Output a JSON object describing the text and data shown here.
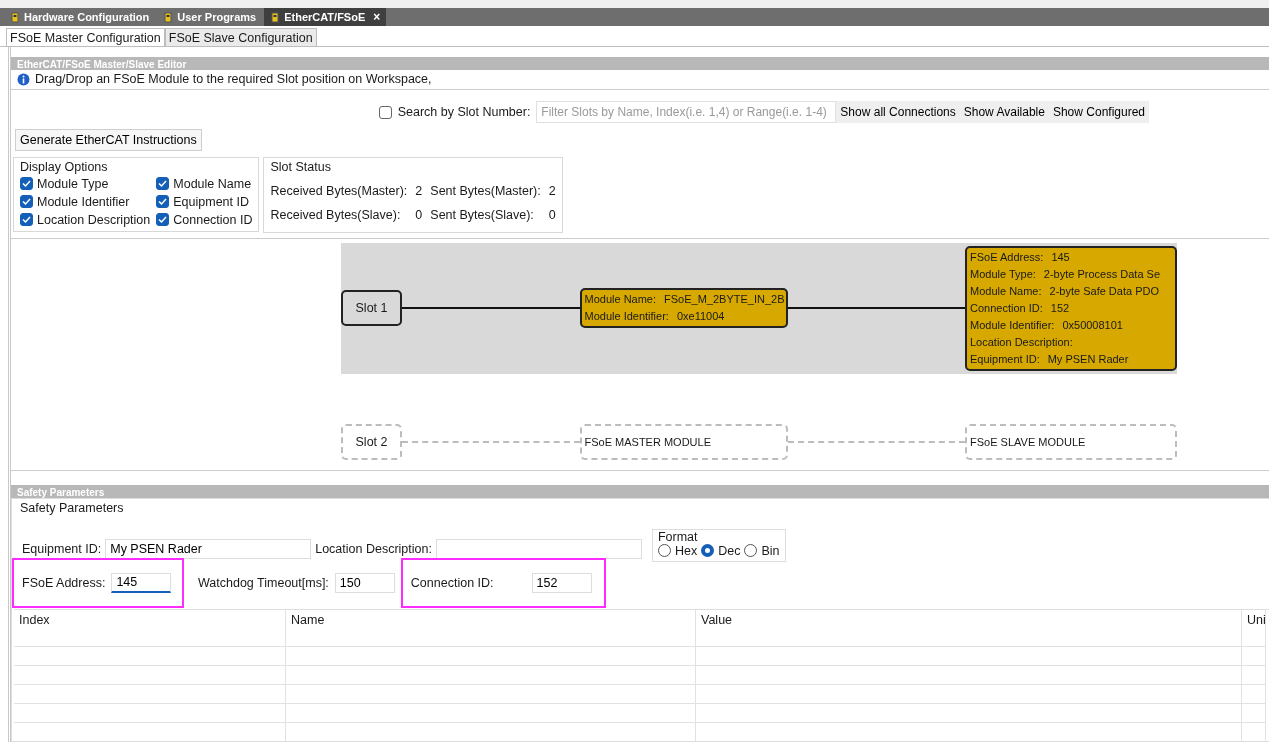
{
  "tabs": [
    {
      "label": "Hardware Configuration",
      "selected": false,
      "closable": false
    },
    {
      "label": "User Programs",
      "selected": false,
      "closable": false
    },
    {
      "label": "EtherCAT/FSoE",
      "selected": true,
      "closable": true
    }
  ],
  "close_glyph": "×",
  "subtabs": [
    {
      "label": "FSoE Master Configuration",
      "selected": true
    },
    {
      "label": "FSoE Slave Configuration",
      "selected": false
    }
  ],
  "editor": {
    "title": "EtherCAT/FSoE Master/Slave Editor",
    "info": "Drag/Drop an FSoE Module to the required Slot position on Workspace,"
  },
  "search": {
    "label": "Search by Slot Number:",
    "checked": false,
    "placeholder": "Filter Slots by Name, Index(i.e. 1,4) or Range(i.e. 1-4)"
  },
  "view_buttons": [
    "Show all Connections",
    "Show Available",
    "Show Configured"
  ],
  "generate_button": "Generate EtherCAT Instructions",
  "display_options": {
    "title": "Display Options",
    "items": [
      {
        "label": "Module Type",
        "checked": true
      },
      {
        "label": "Module Name",
        "checked": true
      },
      {
        "label": "Module Identifier",
        "checked": true
      },
      {
        "label": "Equipment ID",
        "checked": true
      },
      {
        "label": "Location Description",
        "checked": true
      },
      {
        "label": "Connection ID",
        "checked": true
      }
    ]
  },
  "slot_status": {
    "title": "Slot Status",
    "items": [
      {
        "label": "Received Bytes(Master):",
        "value": "2"
      },
      {
        "label": "Sent Bytes(Master):",
        "value": "2"
      },
      {
        "label": "Received Bytes(Slave):",
        "value": "0"
      },
      {
        "label": "Sent Bytes(Slave):",
        "value": "0"
      }
    ]
  },
  "slots": [
    {
      "label": "Slot 1",
      "configured": true,
      "master": [
        {
          "label": "Module Name:",
          "value": "FSoE_M_2BYTE_IN_2B"
        },
        {
          "label": "Module Identifier:",
          "value": "0xe11004"
        }
      ],
      "slave": [
        {
          "label": "FSoE Address:",
          "value": "145"
        },
        {
          "label": "Module Type:",
          "value": "2-byte Process Data Se"
        },
        {
          "label": "Module Name:",
          "value": "2-byte Safe Data PDO"
        },
        {
          "label": "Connection ID:",
          "value": "152"
        },
        {
          "label": "Module Identifier:",
          "value": "0x50008101"
        },
        {
          "label": "Location Description:"
        },
        {
          "label": "Equipment ID:",
          "value": "My PSEN Rader"
        }
      ]
    },
    {
      "label": "Slot 2",
      "configured": false,
      "master_placeholder": "FSoE MASTER MODULE",
      "slave_placeholder": "FSoE SLAVE MODULE"
    }
  ],
  "safety": {
    "header": "Safety Parameters",
    "group_title": "Safety Parameters",
    "equipment_id": {
      "label": "Equipment ID:",
      "value": "My PSEN Rader"
    },
    "location": {
      "label": "Location Description:"
    },
    "format": {
      "title": "Format",
      "options": [
        {
          "label": "Hex",
          "selected": false
        },
        {
          "label": "Dec",
          "selected": true
        },
        {
          "label": "Bin",
          "selected": false
        }
      ]
    },
    "fsoe_address": {
      "label": "FSoE Address:",
      "value": "145",
      "highlighted": true,
      "focused": true
    },
    "watchdog": {
      "label": "Watchdog Timeout[ms]:",
      "value": "150",
      "highlighted": false
    },
    "connection_id": {
      "label": "Connection ID:",
      "value": "152",
      "highlighted": true
    }
  },
  "table": {
    "columns": [
      "Index",
      "Name",
      "Value",
      "Uni"
    ]
  }
}
